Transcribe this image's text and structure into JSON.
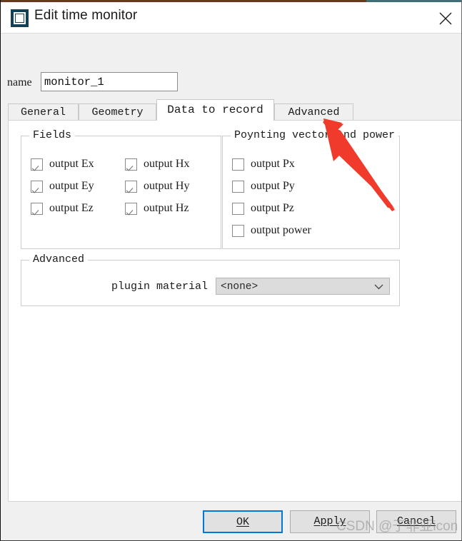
{
  "window": {
    "title": "Edit time monitor",
    "icon": "app-monitor-icon",
    "close_icon": "close-icon"
  },
  "name_row": {
    "label": "name",
    "value": "monitor_1",
    "placeholder": "name"
  },
  "tabs": [
    {
      "label": "General",
      "active": false
    },
    {
      "label": "Geometry",
      "active": false
    },
    {
      "label": "Data to record",
      "active": true
    },
    {
      "label": "Advanced",
      "active": false
    }
  ],
  "fields_group": {
    "title": "Fields",
    "checkboxes": [
      {
        "label": "output Ex",
        "checked": true
      },
      {
        "label": "output Ey",
        "checked": true
      },
      {
        "label": "output Ez",
        "checked": true
      },
      {
        "label": "output Hx",
        "checked": true
      },
      {
        "label": "output Hy",
        "checked": true
      },
      {
        "label": "output Hz",
        "checked": true
      }
    ]
  },
  "poynting_group": {
    "title": "Poynting vector and power",
    "checkboxes": [
      {
        "label": "output Px",
        "checked": false
      },
      {
        "label": "output Py",
        "checked": false
      },
      {
        "label": "output Pz",
        "checked": false
      },
      {
        "label": "output power",
        "checked": false
      }
    ]
  },
  "advanced_group": {
    "title": "Advanced",
    "plugin_material_label": "plugin material",
    "plugin_material_value": "<none>",
    "dropdown_icon": "chevron-down-icon"
  },
  "footer": {
    "ok": "OK",
    "ok_accel": "O",
    "apply": "Apply",
    "apply_accel": "A",
    "cancel": "Cancel",
    "cancel_accel": "C"
  },
  "annotation": {
    "arrow_color": "#f03a2c",
    "name": "red-pointer-arrow"
  },
  "watermark": {
    "text": "CSDN @于非亚icon"
  },
  "colors": {
    "accent_blue": "#0078d7",
    "titlebar_bg": "#ffffff",
    "dialog_bg": "#f0f0f0",
    "page_bg": "#ffffff",
    "icon_navy": "#134057"
  }
}
